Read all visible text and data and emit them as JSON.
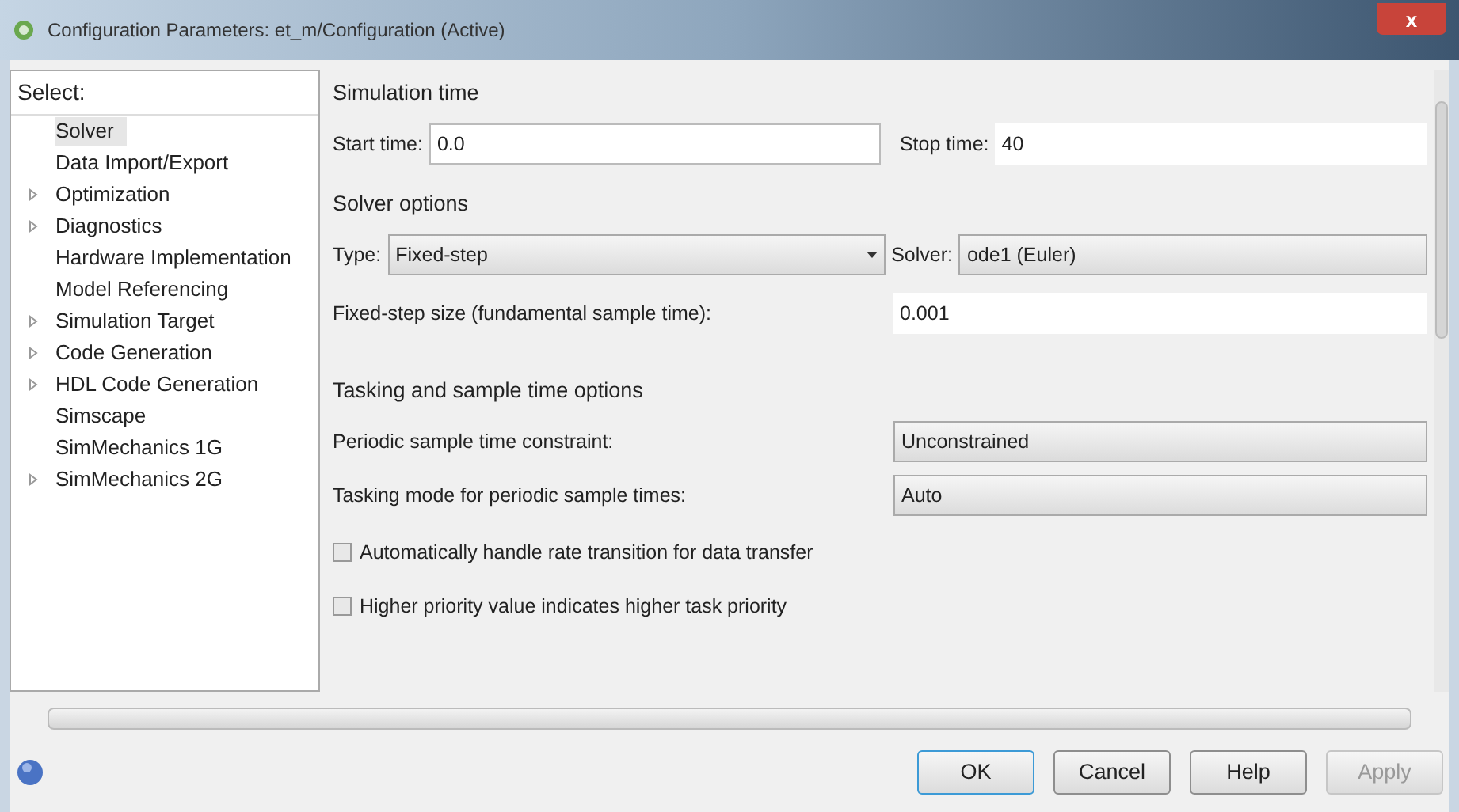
{
  "window": {
    "title": "Configuration Parameters: et_m/Configuration (Active)",
    "close": "x"
  },
  "sidebar": {
    "heading": "Select:",
    "items": [
      {
        "label": "Solver",
        "expandable": false,
        "selected": true
      },
      {
        "label": "Data Import/Export",
        "expandable": false,
        "selected": false
      },
      {
        "label": "Optimization",
        "expandable": true,
        "selected": false
      },
      {
        "label": "Diagnostics",
        "expandable": true,
        "selected": false
      },
      {
        "label": "Hardware Implementation",
        "expandable": false,
        "selected": false
      },
      {
        "label": "Model Referencing",
        "expandable": false,
        "selected": false
      },
      {
        "label": "Simulation Target",
        "expandable": true,
        "selected": false
      },
      {
        "label": "Code Generation",
        "expandable": true,
        "selected": false
      },
      {
        "label": "HDL Code Generation",
        "expandable": true,
        "selected": false
      },
      {
        "label": "Simscape",
        "expandable": false,
        "selected": false
      },
      {
        "label": "SimMechanics 1G",
        "expandable": false,
        "selected": false
      },
      {
        "label": "SimMechanics 2G",
        "expandable": true,
        "selected": false
      }
    ]
  },
  "simulation_time": {
    "heading": "Simulation time",
    "start_label": "Start time:",
    "start_value": "0.0",
    "stop_label": "Stop time:",
    "stop_value": "40"
  },
  "solver_options": {
    "heading": "Solver options",
    "type_label": "Type:",
    "type_value": "Fixed-step",
    "solver_label": "Solver:",
    "solver_value": "ode1 (Euler)",
    "step_label": "Fixed-step size (fundamental sample time):",
    "step_value": "0.001"
  },
  "tasking": {
    "heading": "Tasking and sample time options",
    "periodic_label": "Periodic sample time constraint:",
    "periodic_value": "Unconstrained",
    "mode_label": "Tasking mode for periodic sample times:",
    "mode_value": "Auto",
    "checkboxes": [
      {
        "label": "Automatically handle rate transition for data transfer",
        "checked": false
      },
      {
        "label": "Higher priority value indicates higher task priority",
        "checked": false
      }
    ]
  },
  "buttons": [
    {
      "label": "OK",
      "disabled": false,
      "default": true
    },
    {
      "label": "Cancel",
      "disabled": false,
      "default": false
    },
    {
      "label": "Help",
      "disabled": false,
      "default": false
    },
    {
      "label": "Apply",
      "disabled": true,
      "default": false
    }
  ]
}
